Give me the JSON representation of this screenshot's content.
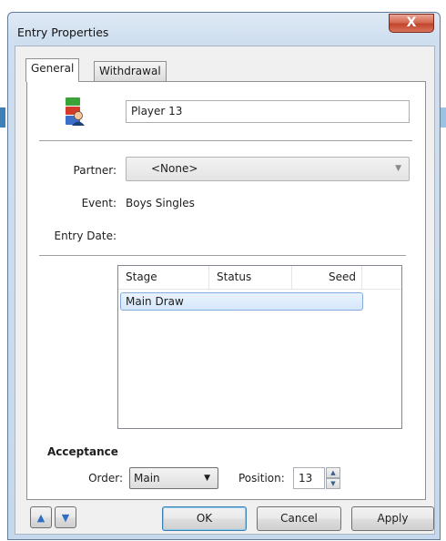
{
  "window": {
    "title": "Entry Properties",
    "close_label": "X"
  },
  "tabs": [
    {
      "label": "General"
    },
    {
      "label": "Withdrawal"
    }
  ],
  "general": {
    "player_name": "Player 13",
    "partner_label": "Partner:",
    "partner_value": "<None>",
    "event_label": "Event:",
    "event_value": "Boys Singles",
    "entry_date_label": "Entry Date:",
    "entry_date_value": ""
  },
  "stages_table": {
    "columns": [
      "Stage",
      "Status",
      "Seed"
    ],
    "rows": [
      {
        "stage": "Main Draw",
        "status": "",
        "seed": ""
      }
    ]
  },
  "acceptance": {
    "heading": "Acceptance",
    "order_label": "Order:",
    "order_value": "Main",
    "position_label": "Position:",
    "position_value": "13"
  },
  "buttons": {
    "ok": "OK",
    "cancel": "Cancel",
    "apply": "Apply"
  },
  "icons": {
    "avatar": "player-avatar-icon",
    "up": "arrow-up-icon",
    "down": "arrow-down-icon"
  }
}
